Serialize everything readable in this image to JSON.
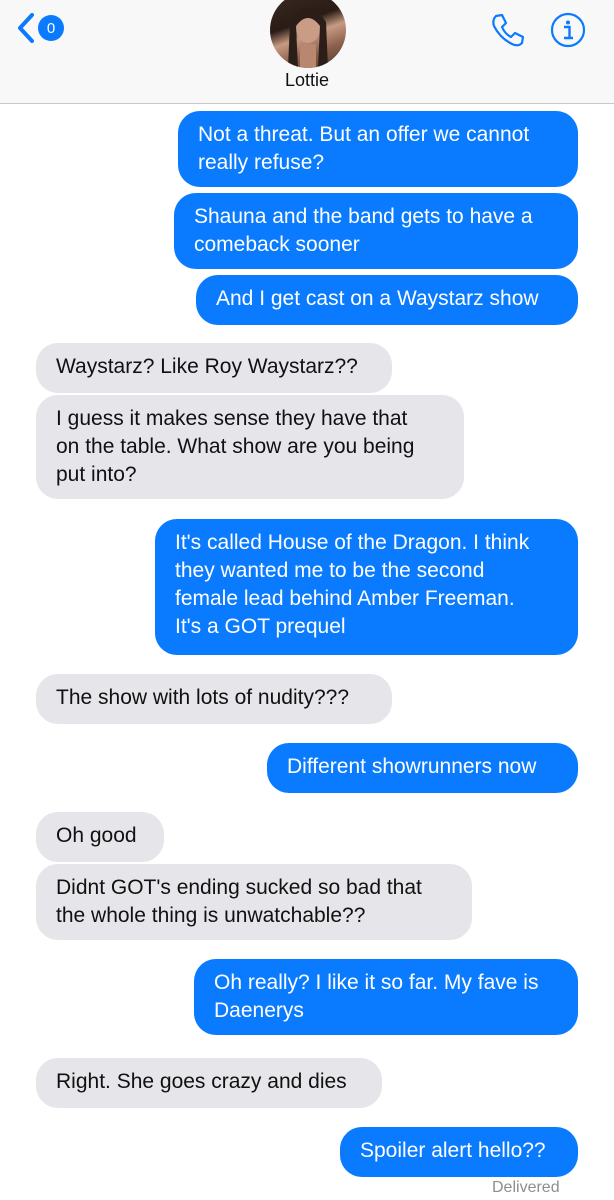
{
  "header": {
    "unread_count": "0",
    "contact_name": "Lottie",
    "accent_color": "#0a7bff",
    "icons": [
      "chevron-left-icon",
      "phone-icon",
      "info-icon"
    ]
  },
  "messages": [
    {
      "from": "me",
      "lines": [
        "Not a threat. But an offer we cannot",
        "really refuse?"
      ]
    },
    {
      "from": "me",
      "lines": [
        "Shauna and the band gets to have a",
        "comeback sooner"
      ]
    },
    {
      "from": "me",
      "lines": [
        "And I get cast on a Waystarz show"
      ]
    },
    {
      "from": "them",
      "lines": [
        "Waystarz? Like Roy Waystarz??"
      ]
    },
    {
      "from": "them",
      "lines": [
        "I guess it makes sense they have that",
        "on the table. What show are you being",
        "put into?"
      ]
    },
    {
      "from": "me",
      "lines": [
        "It's called House of the Dragon. I think",
        "they wanted me to be the second",
        "female lead behind Amber Freeman.",
        "It's a GOT prequel"
      ]
    },
    {
      "from": "them",
      "lines": [
        "The show with lots of nudity???"
      ]
    },
    {
      "from": "me",
      "lines": [
        "Different showrunners now"
      ]
    },
    {
      "from": "them",
      "lines": [
        "Oh good"
      ]
    },
    {
      "from": "them",
      "lines": [
        "Didnt GOT's ending sucked so bad that",
        "the whole thing is unwatchable??"
      ]
    },
    {
      "from": "me",
      "lines": [
        "Oh really? I like it so far. My fave is",
        "Daenerys"
      ]
    },
    {
      "from": "them",
      "lines": [
        "Right. She goes crazy and dies"
      ]
    },
    {
      "from": "me",
      "lines": [
        "Spoiler alert hello??"
      ]
    }
  ],
  "status": "Delivered"
}
